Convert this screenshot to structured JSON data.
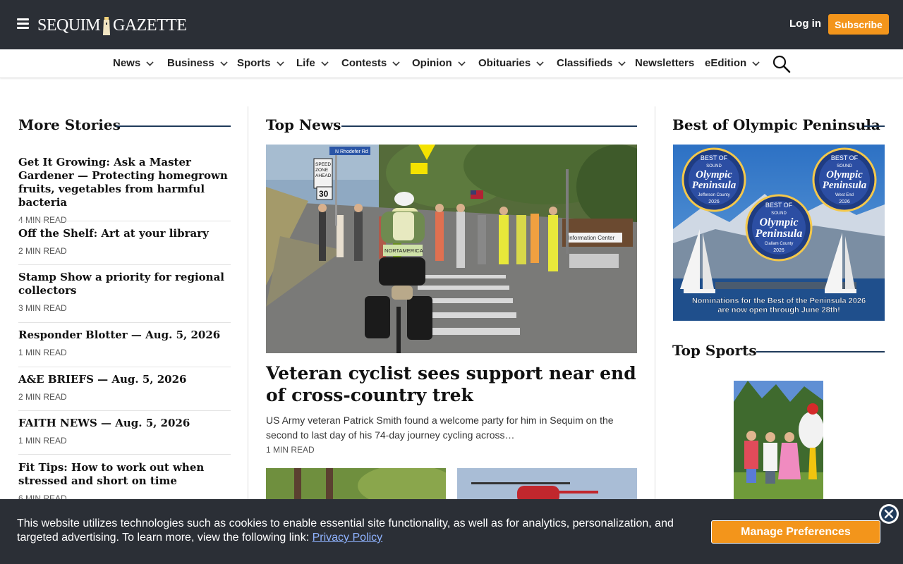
{
  "header": {
    "logo_left": "SEQUIM",
    "logo_right": "GAZETTE",
    "login_label": "Log in",
    "subscribe_label": "Subscribe"
  },
  "nav": {
    "items": [
      {
        "label": "News",
        "dropdown": true
      },
      {
        "label": "Business",
        "dropdown": true
      },
      {
        "label": "Sports",
        "dropdown": true
      },
      {
        "label": "Life",
        "dropdown": true
      },
      {
        "label": "Contests",
        "dropdown": true
      },
      {
        "label": "Opinion",
        "dropdown": true
      },
      {
        "label": "Obituaries",
        "dropdown": true
      },
      {
        "label": "Classifieds",
        "dropdown": true
      },
      {
        "label": "Newsletters",
        "dropdown": false
      },
      {
        "label": "eEdition",
        "dropdown": true
      }
    ]
  },
  "more_stories": {
    "title": "More Stories",
    "items": [
      {
        "title": "Get It Growing: Ask a Master Gardener — Protecting homegrown fruits, vegetables from harmful bacteria",
        "meta": "4 MIN READ"
      },
      {
        "title": "Off the Shelf: Art at your library",
        "meta": "2 MIN READ"
      },
      {
        "title": "Stamp Show a priority for regional collectors",
        "meta": "3 MIN READ"
      },
      {
        "title": "Responder Blotter — Aug. 5, 2026",
        "meta": "1 MIN READ"
      },
      {
        "title": "A&E BRIEFS — Aug. 5, 2026",
        "meta": "2 MIN READ"
      },
      {
        "title": "FAITH NEWS — Aug. 5, 2026",
        "meta": "1 MIN READ"
      },
      {
        "title": "Fit Tips: How to work out when stressed and short on time",
        "meta": "6 MIN READ"
      }
    ]
  },
  "top_news": {
    "title": "Top News",
    "headline": "Veteran cyclist sees support near end of cross-country trek",
    "summary": "US Army veteran Patrick Smith found a welcome party for him in Sequim on the second to last day of his 74-day journey cycling across…",
    "meta": "1 MIN READ",
    "photo_signs": {
      "street": "N Rhodefer Rd",
      "speed_top": "SPEED",
      "speed_mid": "ZONE",
      "speed_bot": "AHEAD",
      "limit": "30",
      "banner": "Information Center",
      "jersey": "NORTAMERICA"
    }
  },
  "best_of": {
    "title": "Best of Olympic Peninsula",
    "ad": {
      "badge_top": "BEST OF",
      "badge_sound": "SOUND",
      "badge_main1": "Olympic",
      "badge_main2": "Peninsula",
      "counties": [
        "Jefferson County",
        "West End",
        "Clallam County"
      ],
      "year": "2026",
      "caption_line1": "Nominations for the Best of the Peninsula 2026",
      "caption_line2": "are now open through June 28th!"
    }
  },
  "top_sports": {
    "title": "Top Sports"
  },
  "cookie": {
    "text": "This website utilizes technologies such as cookies to enable essential site functionality, as well as for analytics, personalization, and targeted advertising. To learn more, view the following link: ",
    "link_label": "Privacy Policy",
    "button_label": "Manage Preferences"
  },
  "colors": {
    "header_bg": "#2b2f36",
    "accent": "#f3951b",
    "rule": "#1f3a5a"
  }
}
